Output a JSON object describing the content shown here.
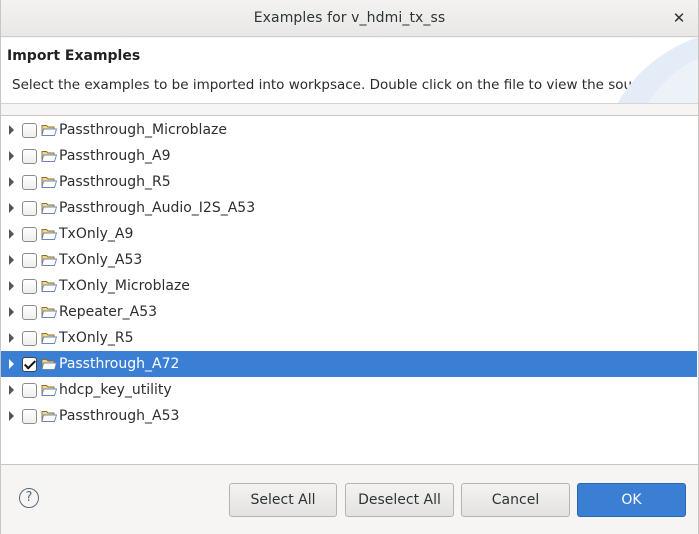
{
  "window": {
    "title": "Examples for v_hdmi_tx_ss",
    "close_glyph": "✕"
  },
  "header": {
    "title": "Import Examples",
    "description": "Select the examples to be imported into workpsace. Double click on the file to view the source."
  },
  "tree": {
    "items": [
      {
        "label": "Passthrough_Microblaze",
        "checked": false,
        "selected": false
      },
      {
        "label": "Passthrough_A9",
        "checked": false,
        "selected": false
      },
      {
        "label": "Passthrough_R5",
        "checked": false,
        "selected": false
      },
      {
        "label": "Passthrough_Audio_I2S_A53",
        "checked": false,
        "selected": false
      },
      {
        "label": "TxOnly_A9",
        "checked": false,
        "selected": false
      },
      {
        "label": "TxOnly_A53",
        "checked": false,
        "selected": false
      },
      {
        "label": "TxOnly_Microblaze",
        "checked": false,
        "selected": false
      },
      {
        "label": "Repeater_A53",
        "checked": false,
        "selected": false
      },
      {
        "label": "TxOnly_R5",
        "checked": false,
        "selected": false
      },
      {
        "label": "Passthrough_A72",
        "checked": true,
        "selected": true
      },
      {
        "label": "hdcp_key_utility",
        "checked": false,
        "selected": false
      },
      {
        "label": "Passthrough_A53",
        "checked": false,
        "selected": false
      }
    ]
  },
  "footer": {
    "help_glyph": "?",
    "select_all_label": "Select All",
    "deselect_all_label": "Deselect All",
    "cancel_label": "Cancel",
    "ok_label": "OK"
  },
  "colors": {
    "selection": "#3b7fd4",
    "ok_button": "#3b7fd4"
  },
  "icons": {
    "expander": "triangle-right-icon",
    "folder": "open-folder-icon",
    "help": "help-circle-icon"
  }
}
